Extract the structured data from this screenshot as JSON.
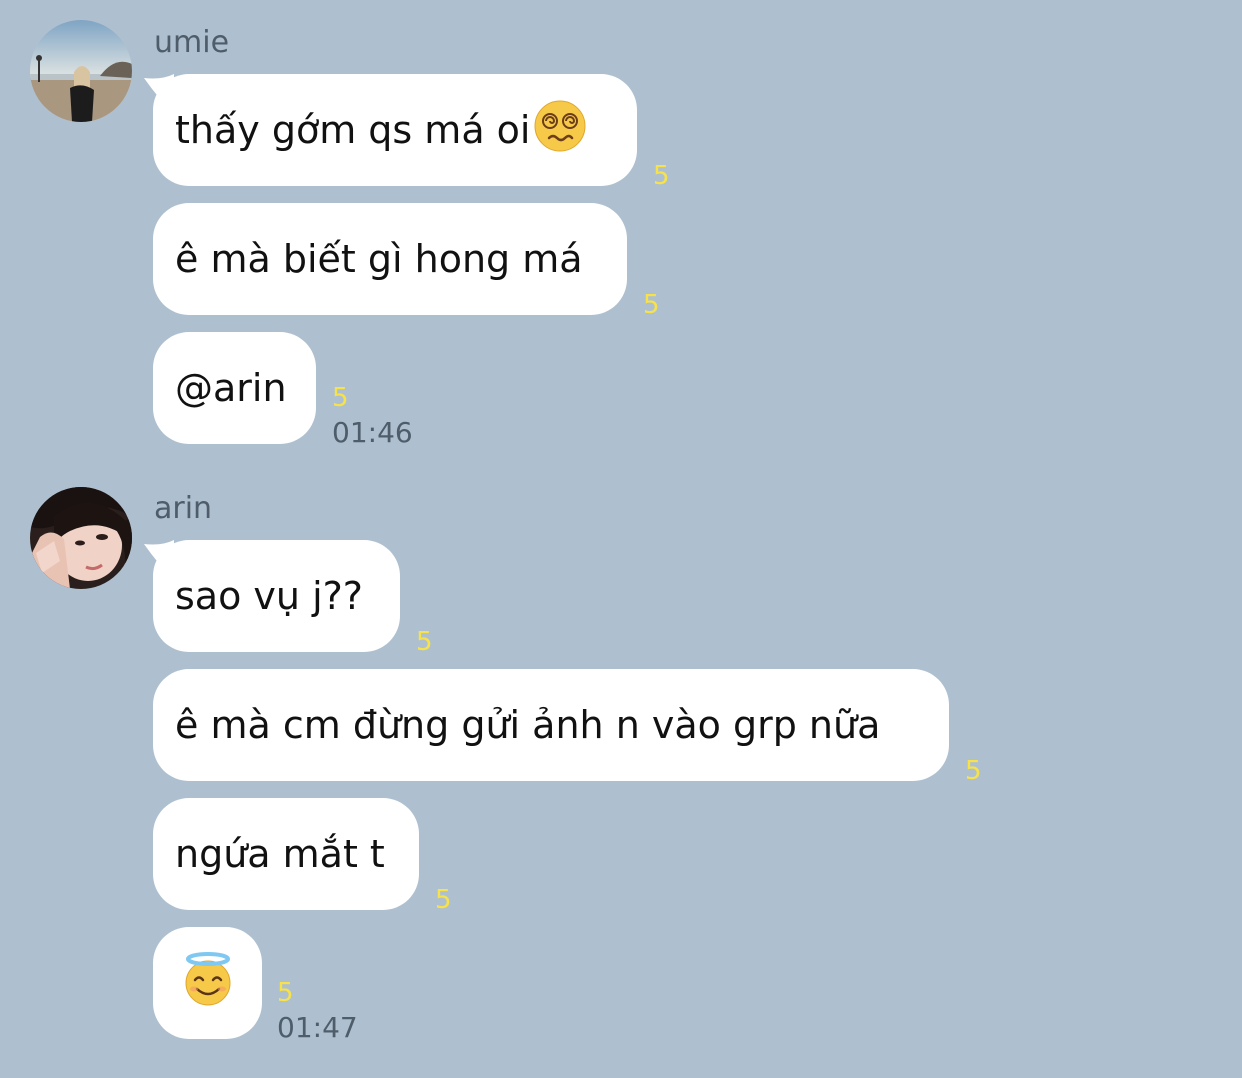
{
  "conversation": [
    {
      "sender": "umie",
      "avatar_icon": "avatar-umie-beach-photo",
      "messages": [
        {
          "text": "thấy gớm qs má oi",
          "trailing_emoji": "dizzy-face-emoji",
          "read_count": "5"
        },
        {
          "text": "ê mà biết gì hong má",
          "read_count": "5"
        },
        {
          "text": "@arin",
          "read_count": "5",
          "time": "01:46"
        }
      ]
    },
    {
      "sender": "arin",
      "avatar_icon": "avatar-arin-selfie-photo",
      "messages": [
        {
          "text": "sao vụ j??",
          "read_count": "5"
        },
        {
          "text": "ê mà cm đừng gửi ảnh n vào grp nữa",
          "read_count": "5"
        },
        {
          "text": "ngứa mắt t",
          "read_count": "5"
        },
        {
          "emoji": "smiling-face-with-halo-emoji",
          "read_count": "5",
          "time": "01:47"
        }
      ]
    }
  ],
  "colors": {
    "background": "#aec0cf",
    "bubble": "#ffffff",
    "read_count": "#f7e24a",
    "meta_text": "#4f5d6b"
  }
}
